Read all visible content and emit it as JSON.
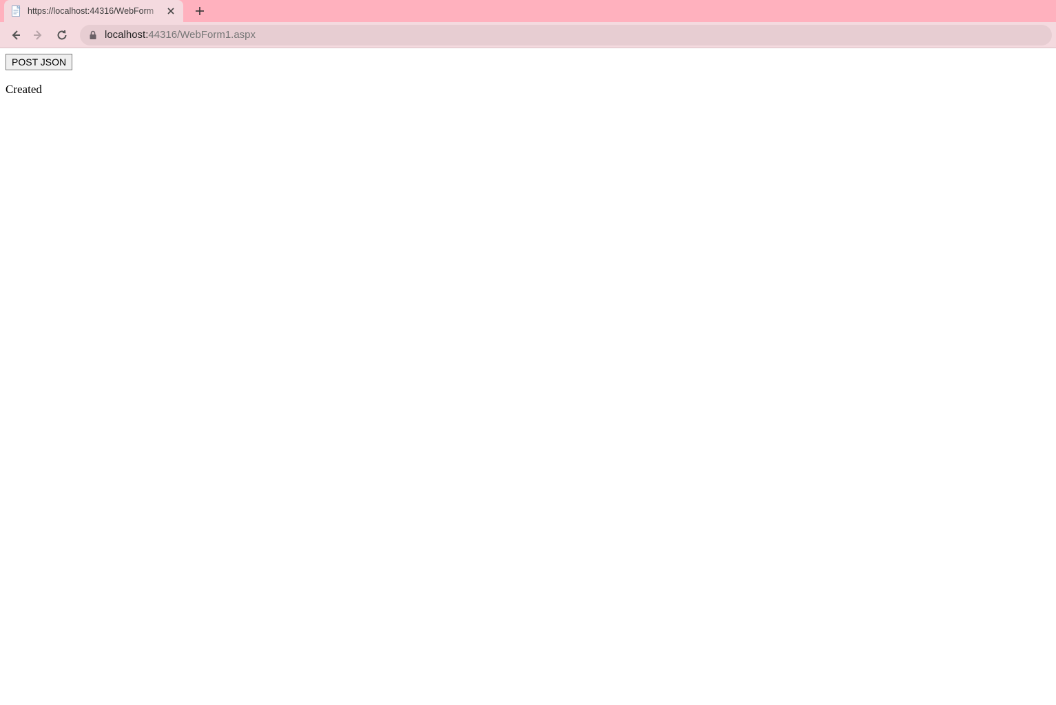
{
  "browser": {
    "tab": {
      "title": "https://localhost:44316/WebForm"
    },
    "address": {
      "host": "localhost:",
      "path": "44316/WebForm1.aspx"
    }
  },
  "page": {
    "button_label": "POST JSON",
    "status_text": "Created"
  }
}
